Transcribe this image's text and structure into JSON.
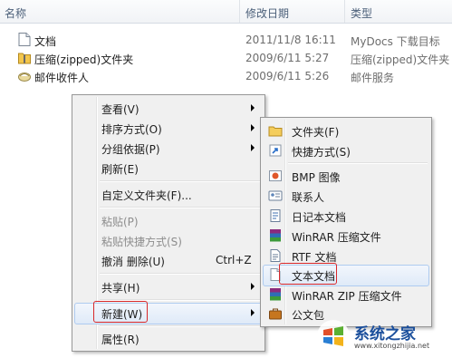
{
  "columns": {
    "name": "名称",
    "date": "修改日期",
    "type": "类型"
  },
  "files": [
    {
      "name": "文档",
      "date": "2011/11/8 16:11",
      "type": "MyDocs 下载目标",
      "icon": "document-icon"
    },
    {
      "name": "压缩(zipped)文件夹",
      "date": "2009/6/11 5:27",
      "type": "压缩(zipped)文件夹",
      "icon": "zip-folder-icon"
    },
    {
      "name": "邮件收件人",
      "date": "2009/6/11 5:26",
      "type": "邮件服务",
      "icon": "mail-recipient-icon"
    }
  ],
  "context_menu": {
    "view": "查看(V)",
    "sort": "排序方式(O)",
    "group": "分组依据(P)",
    "refresh": "刷新(E)",
    "customize": "自定义文件夹(F)...",
    "paste": "粘贴(P)",
    "paste_shortcut": "粘贴快捷方式(S)",
    "undo": "撤消 删除(U)",
    "undo_shortcut": "Ctrl+Z",
    "share": "共享(H)",
    "new": "新建(W)",
    "properties": "属性(R)"
  },
  "new_submenu": {
    "folder": "文件夹(F)",
    "shortcut": "快捷方式(S)",
    "bmp": "BMP 图像",
    "contact": "联系人",
    "journal": "日记本文档",
    "winrar": "WinRAR 压缩文件",
    "rtf": "RTF 文档",
    "text": "文本文档",
    "winrar_zip": "WinRAR ZIP 压缩文件",
    "briefcase": "公文包"
  },
  "watermark": {
    "text": "系统之家",
    "url": "www.xitongzhijia.net"
  },
  "colors": {
    "highlight_border": "#d8282a",
    "menu_bg": "#f0f0f0"
  }
}
